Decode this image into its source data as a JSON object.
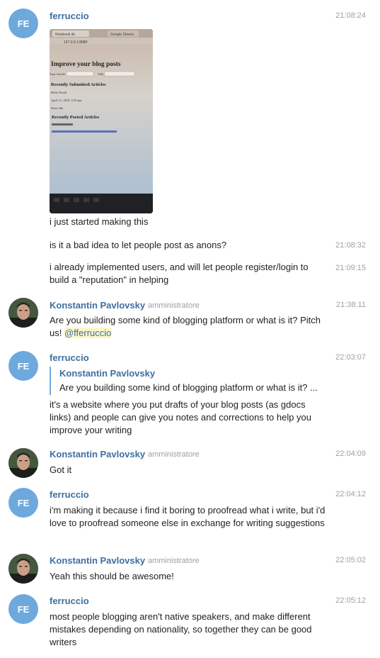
{
  "colors": {
    "link": "#3d6f9f",
    "avatar_fe": "#6ea9dd",
    "time": "#a0a0a0",
    "mention_bg": "#fdf6c8"
  },
  "avatars": {
    "fe_initials": "FE"
  },
  "users": {
    "ferruccio": "ferruccio",
    "konstantin": "Konstantin Pavlovsky",
    "konstantin_role": "amministratore"
  },
  "photo": {
    "tab1": "Notebook lib",
    "tab2": "Google Sheets",
    "url": "127.0.0.1:8080",
    "heading": "Improve your blog posts",
    "your_article": "Your Article",
    "title": "Title",
    "submitted_heading": "Recently Submitted Articles",
    "submitted_line1": "Hello World",
    "submitted_line2": "April 21, 2019, 5:30 pm",
    "submitted_line3": "Show Me",
    "posted_heading": "Recently Posted Articles"
  },
  "messages": [
    {
      "time": "21:08:24",
      "text": "i just started making this"
    },
    {
      "time": "21:08:32",
      "text": "is it a bad idea to let people post as anons?"
    },
    {
      "time": "21:09:15",
      "text": "i already implemented users, and will let people register/login to build a \"reputation\" in helping"
    },
    {
      "time": "21:38:11",
      "text": "Are you building some kind of blogging platform or what is it? Pitch us!",
      "mention": "@fferruccio"
    },
    {
      "time": "22:03:07",
      "quote_author": "Konstantin Pavlovsky",
      "quote_text": "Are you building some kind of blogging platform or what is it? ...",
      "text": "it's a website where you put drafts of your blog posts (as gdocs links) and people can give you notes and corrections to help you improve your writing"
    },
    {
      "time": "22:04:09",
      "text": "Got it"
    },
    {
      "time": "22:04:12",
      "text": "i'm making it because i find it boring to proofread what i write, but i'd love to proofread someone else in exchange for writing suggestions"
    },
    {
      "time": "22:05:02",
      "text": "Yeah this should be awesome!"
    },
    {
      "time": "22:05:12",
      "text": "most people blogging aren't native speakers, and make different mistakes depending on nationality, so together they can be good writers"
    }
  ]
}
